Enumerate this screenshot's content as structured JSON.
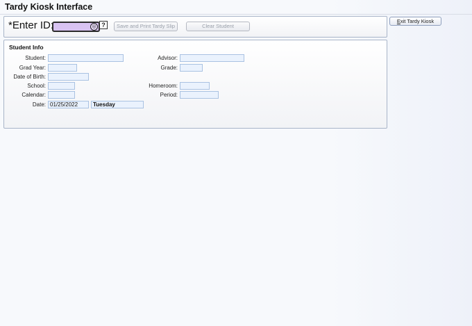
{
  "app": {
    "title": "Tardy Kiosk Interface"
  },
  "entry": {
    "label": "*Enter ID:",
    "id_value": "",
    "fingerprint_icon": "fingerprint-icon",
    "help_glyph": "?",
    "save_button": "Save and Print Tardy Slip",
    "clear_button": "Clear Student"
  },
  "exit_button": {
    "accel": "E",
    "rest": "xit Tardy Kiosk"
  },
  "student_info": {
    "heading": "Student Info",
    "labels": {
      "student": "Student:",
      "grad_year": "Grad Year:",
      "dob": "Date of Birth:",
      "school": "School:",
      "calendar": "Calendar:",
      "date": "Date:",
      "advisor": "Advisor:",
      "grade": "Grade:",
      "homeroom": "Homeroom:",
      "period": "Period:"
    },
    "values": {
      "student": "",
      "grad_year": "",
      "dob": "",
      "school": "",
      "calendar": "",
      "date": "01/25/2022",
      "day": "Tuesday",
      "advisor": "",
      "grade": "",
      "homeroom": "",
      "period": ""
    }
  },
  "colors": {
    "id_input_bg": "#d9c3f2",
    "field_bg": "#eaf2fd",
    "field_border": "#a9c2e2",
    "panel_border": "#a8b4c8"
  }
}
